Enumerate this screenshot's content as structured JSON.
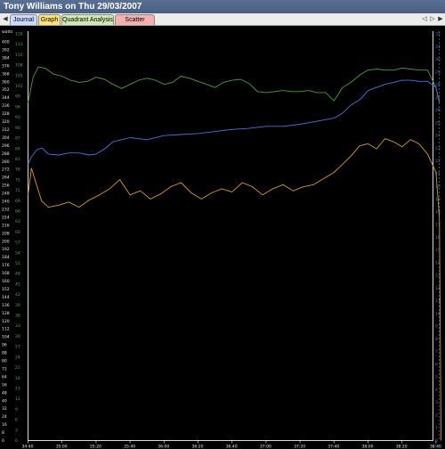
{
  "window": {
    "title": "Tony Williams on Thu 29/03/2007"
  },
  "tabs": [
    {
      "label": "Journal",
      "color": "#c9d9ff"
    },
    {
      "label": "Graph",
      "color": "#ffe27a"
    },
    {
      "label": "Quadrant Analysis",
      "color": "#cfe9b3"
    },
    {
      "label": "Scatter Graph",
      "color": "#f5b0b0"
    }
  ],
  "nav": {
    "prev_icon": "◀",
    "left_icon": "◁",
    "right_icon": "▷",
    "next_icon": "▶"
  },
  "chart_data": {
    "type": "line",
    "left_axis_unit": "watts",
    "x_ticks": [
      "34:40",
      "35:00",
      "35:20",
      "35:40",
      "36:00",
      "36:20",
      "36:40",
      "37:00",
      "37:20",
      "37:40",
      "38:00",
      "38:20",
      "38:40"
    ],
    "x_range": [
      "34:40",
      "38:43"
    ],
    "y_ticks_watts": [
      400,
      392,
      384,
      376,
      368,
      360,
      352,
      344,
      336,
      328,
      320,
      312,
      304,
      296,
      288,
      280,
      272,
      264,
      256,
      248,
      240,
      232,
      224,
      216,
      208,
      200,
      192,
      184,
      176,
      168,
      160,
      152,
      144,
      136,
      128,
      120,
      112,
      104,
      96,
      88,
      80,
      72,
      64,
      56,
      48,
      40,
      32,
      24,
      16,
      8,
      0
    ],
    "y_ticks_green": [
      116,
      113,
      110,
      108,
      105,
      102,
      99,
      96,
      93,
      90,
      87,
      84,
      81,
      78,
      75,
      72,
      69,
      66,
      63,
      60,
      57,
      54,
      51,
      48,
      45,
      42,
      39,
      36,
      33,
      30,
      27,
      24,
      21,
      18,
      15,
      12,
      9,
      6,
      3,
      0
    ],
    "right_ticks": [
      32,
      31,
      30,
      29,
      28,
      27,
      26,
      25,
      24,
      23,
      22,
      21,
      20,
      19,
      18,
      17,
      16,
      15,
      14,
      13,
      12,
      11,
      10,
      9,
      8,
      7,
      6,
      5,
      4,
      3,
      2,
      1,
      0
    ],
    "ylim_watts": [
      0,
      400
    ],
    "grid": false,
    "series": [
      {
        "color": "#4f9a3f",
        "axis": "watts",
        "x_seconds": [
          0,
          3,
          6,
          10,
          15,
          20,
          25,
          30,
          35,
          40,
          45,
          50,
          55,
          60,
          65,
          70,
          75,
          80,
          85,
          90,
          95,
          100,
          105,
          110,
          115,
          120,
          125,
          130,
          135,
          140,
          145,
          150,
          155,
          160,
          165,
          170,
          175,
          180,
          185,
          190,
          195,
          198,
          200,
          205,
          210,
          215,
          220,
          225,
          230,
          235,
          240,
          242
        ],
        "values": [
          330,
          355,
          365,
          364,
          358,
          356,
          352,
          350,
          351,
          355,
          353,
          348,
          344,
          348,
          352,
          354,
          352,
          348,
          350,
          356,
          354,
          351,
          348,
          345,
          350,
          352,
          353,
          349,
          341,
          340,
          341,
          342,
          341,
          341,
          342,
          340,
          340,
          332,
          345,
          350,
          357,
          360,
          362,
          363,
          362,
          362,
          364,
          363,
          362,
          362,
          345,
          330
        ]
      },
      {
        "color": "#4d72d8",
        "axis": "watts",
        "x_seconds": [
          0,
          2,
          5,
          8,
          12,
          18,
          24,
          30,
          36,
          40,
          45,
          50,
          55,
          60,
          70,
          80,
          90,
          100,
          110,
          120,
          130,
          140,
          150,
          160,
          170,
          180,
          185,
          190,
          195,
          198,
          200,
          205,
          210,
          215,
          220,
          225,
          230,
          235,
          240,
          242
        ],
        "values": [
          270,
          277,
          284,
          286,
          280,
          279,
          281,
          281,
          279,
          280,
          285,
          292,
          294,
          296,
          294,
          298,
          299,
          300,
          302,
          304,
          305,
          307,
          307,
          309,
          312,
          315,
          320,
          328,
          333,
          338,
          342,
          345,
          348,
          350,
          352,
          352,
          351,
          351,
          345,
          330
        ]
      },
      {
        "color": "#d19a3a",
        "axis": "watts",
        "x_seconds": [
          0,
          2,
          5,
          8,
          12,
          18,
          24,
          30,
          36,
          42,
          48,
          54,
          60,
          66,
          72,
          78,
          84,
          90,
          96,
          102,
          108,
          114,
          120,
          126,
          132,
          138,
          144,
          150,
          156,
          162,
          168,
          174,
          180,
          185,
          190,
          195,
          200,
          205,
          210,
          215,
          220,
          225,
          230,
          235,
          240,
          242,
          243
        ],
        "values": [
          240,
          266,
          250,
          234,
          228,
          230,
          233,
          228,
          235,
          240,
          246,
          255,
          240,
          244,
          236,
          241,
          248,
          252,
          242,
          236,
          242,
          246,
          243,
          252,
          248,
          240,
          246,
          250,
          244,
          248,
          250,
          256,
          262,
          270,
          278,
          288,
          290,
          285,
          295,
          292,
          287,
          294,
          290,
          280,
          262,
          218,
          0
        ]
      }
    ]
  }
}
